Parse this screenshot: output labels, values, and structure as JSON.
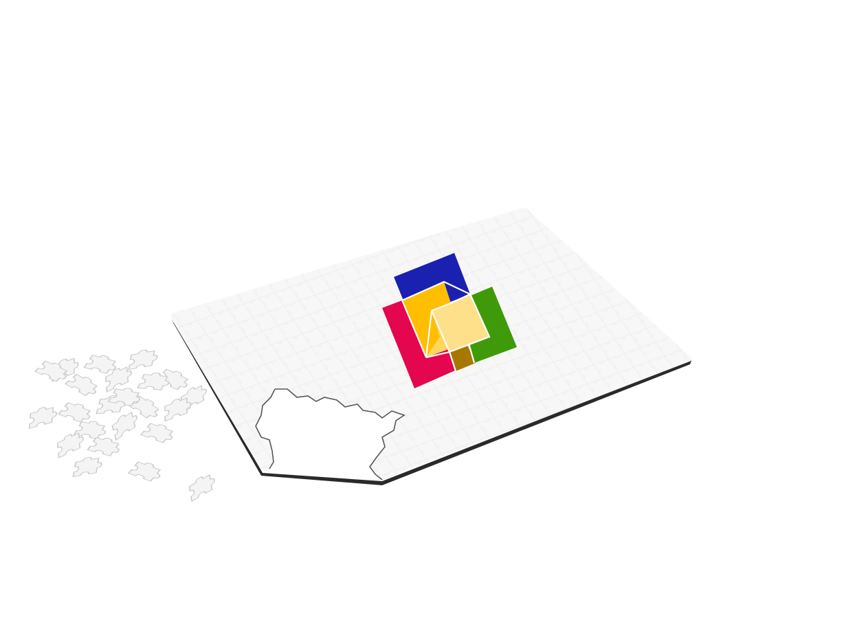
{
  "scene": {
    "subject": "jigsaw-puzzle",
    "background_color": "#ffffff",
    "board_color": "#f7f7f7",
    "board_edge_color": "#2a2a2a",
    "piece_color": "#f4f4f4",
    "piece_outline_color": "#c9c9c9"
  },
  "logo": {
    "colors": {
      "blue": "#1a21b0",
      "red": "#e4064e",
      "green": "#3f9a0a",
      "orange": "#ffbe00",
      "yellow_light": "#ffd75e",
      "yellow_pale": "#ffe08a",
      "brown": "#a77800"
    }
  }
}
